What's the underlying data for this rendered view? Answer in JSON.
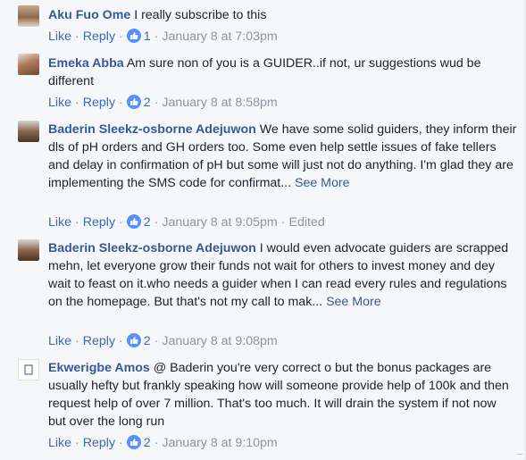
{
  "comments": [
    {
      "author": "Aku Fuo Ome",
      "text": "I really subscribe to this",
      "see_more": "",
      "actions": {
        "like": "Like",
        "reply": "Reply",
        "likes": "1",
        "time": "January 8 at 7:03pm",
        "edited": ""
      }
    },
    {
      "author": "Emeka Abba",
      "text": "Am sure non of you is a GUIDER..if not, ur suggestions wud be different",
      "see_more": "",
      "actions": {
        "like": "Like",
        "reply": "Reply",
        "likes": "2",
        "time": "January 8 at 8:58pm",
        "edited": ""
      }
    },
    {
      "author": "Baderin Sleekz-osborne Adejuwon",
      "text": "We have some solid guiders, they inform their dls of pH orders and GH orders too. Some even help settle issues of fake tellers and delay in confirmation of pH but some will just not do anything. I'm glad they are implementing the SMS code for confirmat...",
      "see_more": "See More",
      "actions": {
        "like": "Like",
        "reply": "Reply",
        "likes": "2",
        "time": "January 8 at 9:05pm",
        "edited": "Edited"
      }
    },
    {
      "author": "Baderin Sleekz-osborne Adejuwon",
      "text": "I would even advocate guiders are scrapped mehn, let everyone grow their funds not wait for others to invest money and dey wait to feast on it.who needs a guider when I can read every rules and regulations on the homepage. But that's not my call to mak...",
      "see_more": "See More",
      "actions": {
        "like": "Like",
        "reply": "Reply",
        "likes": "2",
        "time": "January 8 at 9:08pm",
        "edited": ""
      }
    },
    {
      "author": "Ekwerigbe Amos",
      "text": "@ Baderin you're very correct o but the bonus packages are usually hefty but frankly speaking how will someone provide help of 100k and then request help of over 7 million. That's too much. It will drain the system if not now but over the long run",
      "see_more": "",
      "actions": {
        "like": "Like",
        "reply": "Reply",
        "likes": "2",
        "time": "January 8 at 9:10pm",
        "edited": ""
      }
    }
  ],
  "colors": {
    "author": "#365899",
    "link": "#4267b2",
    "meta": "#90949c",
    "like_badge": "#5890ff",
    "background": "#f6f7f9"
  },
  "icons": {
    "like_badge": "thumbs-up-icon"
  }
}
